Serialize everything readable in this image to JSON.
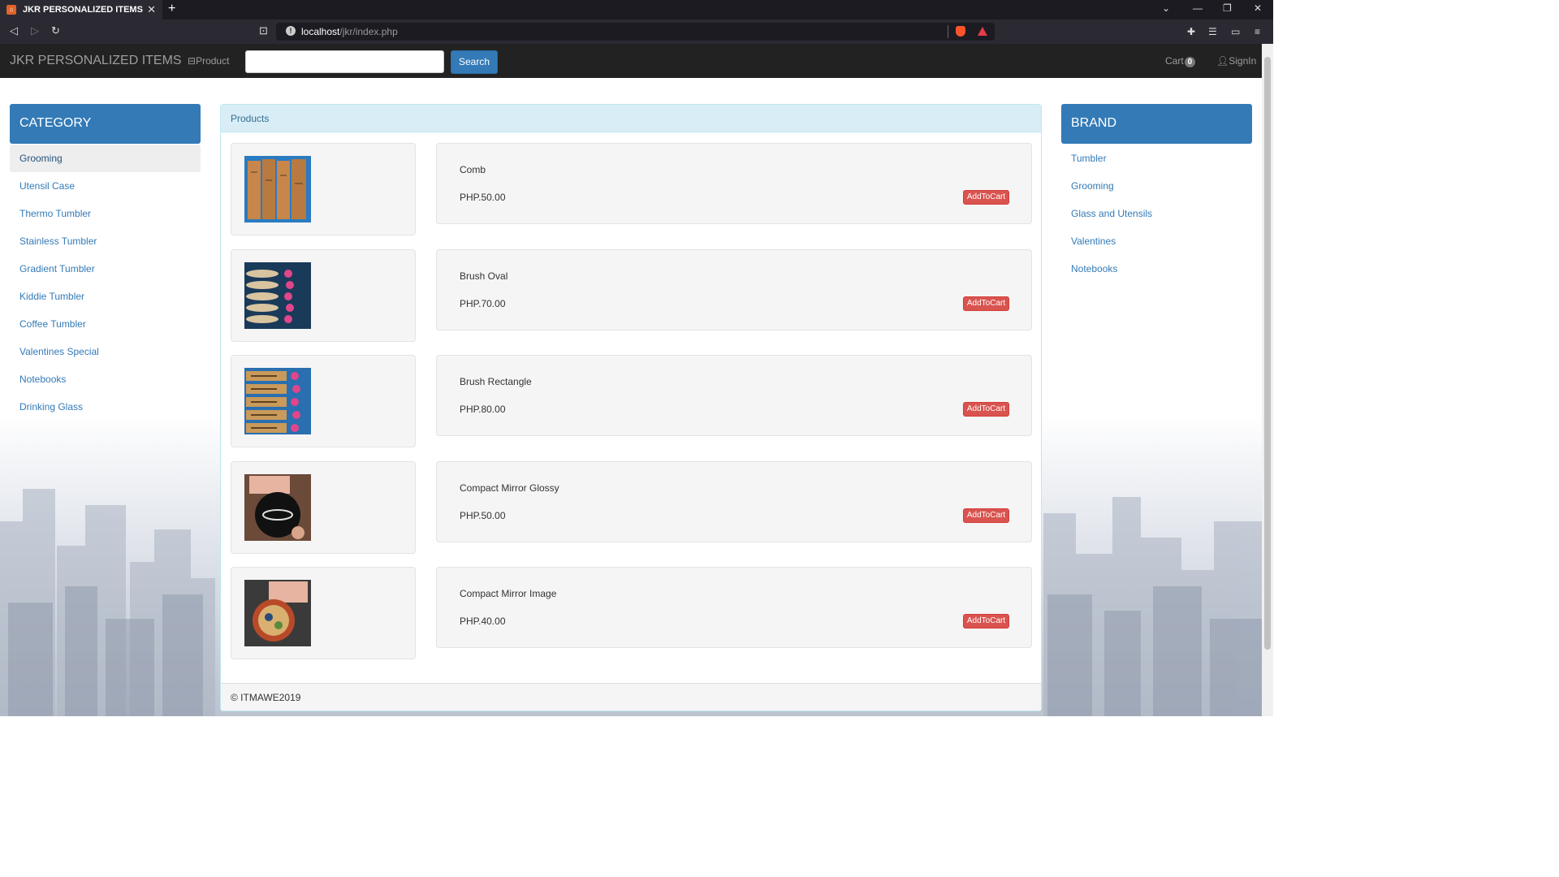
{
  "browser": {
    "tab_title": "JKR PERSONALIZED ITEMS",
    "tab_close": "✕",
    "new_tab": "+",
    "url_host": "localhost",
    "url_path": "/jkr/index.php",
    "window_controls": [
      "⌄",
      "—",
      "❐",
      "✕"
    ]
  },
  "navbar": {
    "brand": "JKR PERSONALIZED ITEMS",
    "product_link": "Product",
    "search_placeholder": "",
    "search_button": "Search",
    "cart_label": "Cart",
    "cart_count": "0",
    "signin_label": "SignIn"
  },
  "category": {
    "title": "CATEGORY",
    "items": [
      {
        "label": "Grooming"
      },
      {
        "label": "Utensil Case"
      },
      {
        "label": "Thermo Tumbler"
      },
      {
        "label": "Stainless Tumbler"
      },
      {
        "label": "Gradient Tumbler"
      },
      {
        "label": "Kiddie Tumbler"
      },
      {
        "label": "Coffee Tumbler"
      },
      {
        "label": "Valentines Special"
      },
      {
        "label": "Notebooks"
      },
      {
        "label": "Drinking Glass"
      }
    ]
  },
  "brand_sidebar": {
    "title": "BRAND",
    "items": [
      {
        "label": "Tumbler"
      },
      {
        "label": "Grooming"
      },
      {
        "label": "Glass and Utensils"
      },
      {
        "label": "Valentines"
      },
      {
        "label": "Notebooks"
      }
    ]
  },
  "products_panel": {
    "heading": "Products",
    "footer": "© ITMAWE2019",
    "add_to_cart_label": "AddToCart",
    "items": [
      {
        "name": "Comb",
        "price": "PHP.50.00"
      },
      {
        "name": "Brush Oval",
        "price": "PHP.70.00"
      },
      {
        "name": "Brush Rectangle",
        "price": "PHP.80.00"
      },
      {
        "name": "Compact Mirror Glossy",
        "price": "PHP.50.00"
      },
      {
        "name": "Compact Mirror Image",
        "price": "PHP.40.00"
      }
    ]
  },
  "colors": {
    "primary": "#337ab7",
    "danger": "#d9534f",
    "navbar": "#222222",
    "panel_heading": "#d9edf7"
  }
}
